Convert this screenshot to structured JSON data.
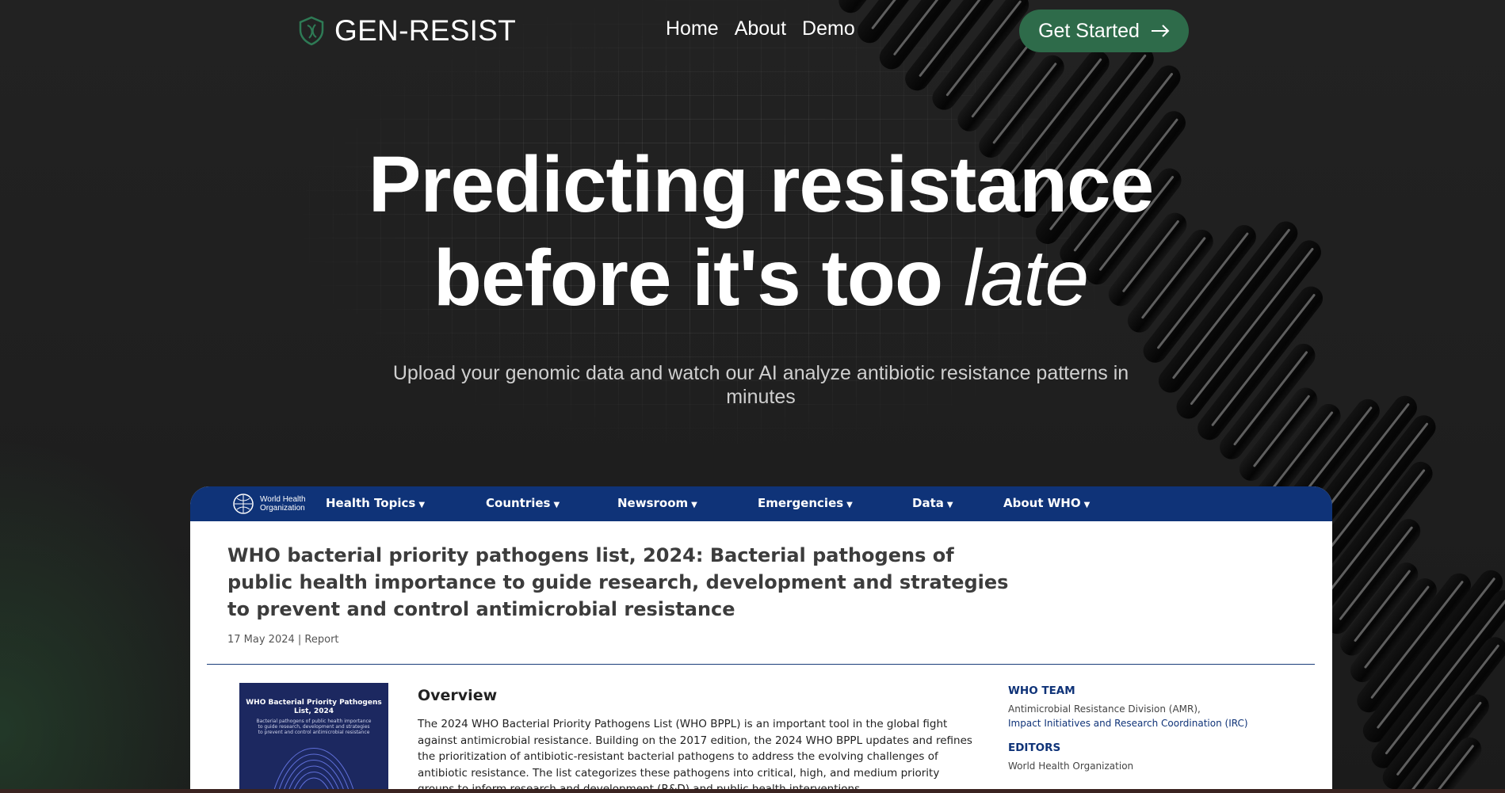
{
  "nav": {
    "brand": "GEN-RESIST",
    "links": [
      "Home",
      "About",
      "Demo"
    ],
    "cta_label": "Get Started"
  },
  "hero": {
    "title_line1": "Predicting resistance",
    "title_line2_main": "before it's too",
    "title_line2_italic": "late",
    "subtitle": "Upload your genomic data and watch our AI analyze antibiotic resistance patterns in minutes"
  },
  "who": {
    "logo_line1": "World Health",
    "logo_line2": "Organization",
    "menu": [
      "Health Topics",
      "Countries",
      "Newsroom",
      "Emergencies",
      "Data",
      "About WHO"
    ],
    "title": "WHO bacterial priority pathogens list, 2024: Bacterial pathogens of public health importance to guide research, development and strategies to prevent and control antimicrobial resistance",
    "meta": "17 May 2024 | Report",
    "cover_title": "WHO Bacterial Priority Pathogens List, 2024",
    "cover_subtitle": "Bacterial pathogens of public health importance to guide research, development and strategies to prevent and control antimicrobial resistance",
    "overview_heading": "Overview",
    "overview_text": "The 2024 WHO Bacterial Priority Pathogens List (WHO BPPL) is an important tool in the global fight against antimicrobial resistance. Building on the 2017 edition, the 2024 WHO BPPL updates and refines the prioritization of antibiotic-resistant bacterial pathogens to address the evolving challenges of antibiotic resistance. The list categorizes these pathogens into critical, high, and medium priority groups to inform research and development (R&D) and public health interventions.",
    "team_heading": "WHO TEAM",
    "team_text": "Antimicrobial Resistance Division (AMR),",
    "team_link": "Impact Initiatives and Research Coordination (IRC)",
    "editors_heading": "EDITORS",
    "editors_text": "World Health Organization"
  },
  "colors": {
    "background": "#1c1c1c",
    "cta": "#2e6b4a",
    "who_blue": "#0f3378"
  }
}
